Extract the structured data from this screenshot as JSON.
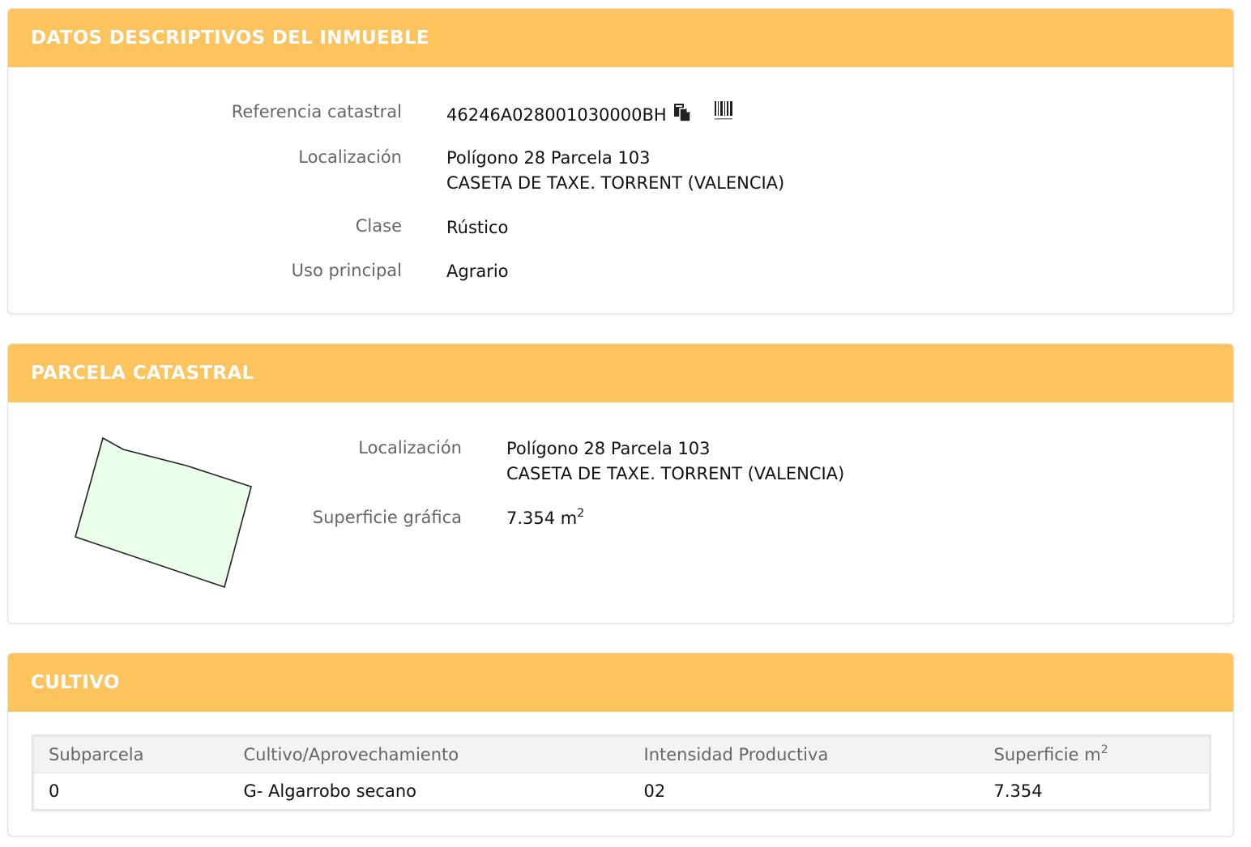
{
  "datos": {
    "title": "DATOS DESCRIPTIVOS DEL INMUEBLE",
    "referencia_label": "Referencia catastral",
    "referencia_value": "46246A028001030000BH",
    "copy_icon": "copy-icon",
    "barcode_icon": "barcode-icon",
    "localizacion_label": "Localización",
    "localizacion_line1": "Polígono 28 Parcela 103",
    "localizacion_line2": "CASETA DE TAXE. TORRENT (VALENCIA)",
    "clase_label": "Clase",
    "clase_value": "Rústico",
    "uso_label": "Uso principal",
    "uso_value": "Agrario"
  },
  "parcela": {
    "title": "PARCELA CATASTRAL",
    "localizacion_label": "Localización",
    "localizacion_line1": "Polígono 28 Parcela 103",
    "localizacion_line2": "CASETA DE TAXE. TORRENT (VALENCIA)",
    "superficie_label": "Superficie gráfica",
    "superficie_value": "7.354 m",
    "superficie_exp": "2",
    "parcel_fill": "#eaffea",
    "parcel_stroke": "#222222"
  },
  "cultivo": {
    "title": "CULTIVO",
    "headers": [
      "Subparcela",
      "Cultivo/Aprovechamiento",
      "Intensidad Productiva",
      "Superficie m"
    ],
    "header_exp": "2",
    "rows": [
      [
        "0",
        "G- Algarrobo secano",
        "02",
        "7.354"
      ]
    ]
  },
  "colors": {
    "header_bg": "#fdc45e",
    "header_text": "#ffffff",
    "label_text": "#666666"
  }
}
